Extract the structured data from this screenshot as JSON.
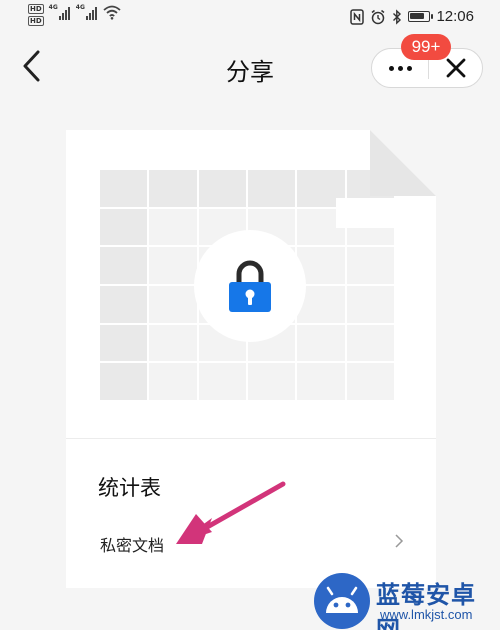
{
  "status_bar": {
    "hd_1": "HD",
    "hd_2": "HD",
    "network_1": "4G",
    "network_2": "4G",
    "time": "12:06",
    "battery_level": 0.8
  },
  "nav": {
    "title": "分享",
    "badge_count": "99+"
  },
  "card": {
    "doc_name": "统计表",
    "privacy_label": "私密文档"
  },
  "watermark": {
    "name": "蓝莓安卓网",
    "url": "www.lmkjst.com"
  },
  "colors": {
    "lock": "#1677e8",
    "badge": "#f24b40",
    "arrow": "#d2347a",
    "watermark": "#2d67c6"
  },
  "icons": [
    "wifi-icon",
    "nfc-icon",
    "alarm-icon",
    "bluetooth-icon",
    "battery-icon",
    "back-icon",
    "more-icon",
    "close-icon",
    "lock-icon",
    "chevron-right-icon",
    "android-logo-icon"
  ]
}
